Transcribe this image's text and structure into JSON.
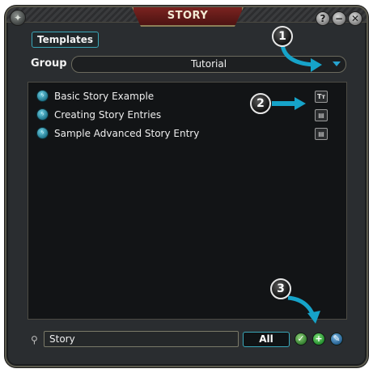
{
  "window": {
    "title": "STORY",
    "help_label": "?",
    "minimize_label": "−",
    "close_label": "✕"
  },
  "tabs": {
    "templates_label": "Templates"
  },
  "group": {
    "label": "Group",
    "selected": "Tutorial"
  },
  "list": {
    "items": [
      {
        "label": "Basic Story Example",
        "type_icon": "Tт"
      },
      {
        "label": "Creating Story Entries",
        "type_icon": "▤"
      },
      {
        "label": "Sample Advanced Story Entry",
        "type_icon": "▤"
      }
    ]
  },
  "footer": {
    "search_value": "Story",
    "all_label": "All",
    "add_label": "+"
  },
  "callouts": [
    "1",
    "2",
    "3"
  ],
  "colors": {
    "accent": "#27a3d0",
    "title_bg": "#6a1c1a",
    "panel_bg": "#121416"
  }
}
